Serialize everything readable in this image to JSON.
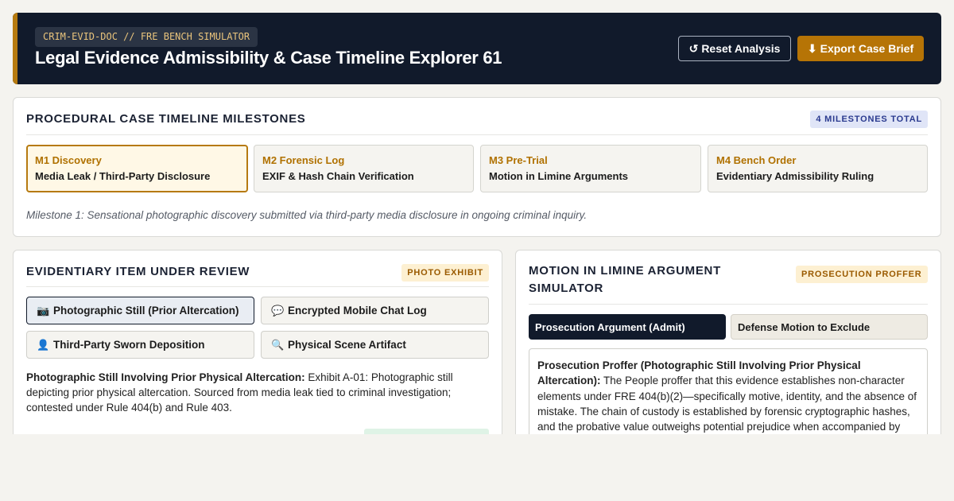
{
  "header": {
    "tag": "CRIM-EVID-DOC // FRE BENCH SIMULATOR",
    "title": "Legal Evidence Admissibility & Case Timeline Explorer 61",
    "reset_icon": "↺",
    "reset_label": "Reset Analysis",
    "export_icon": "⬇",
    "export_label": "Export Case Brief"
  },
  "timeline": {
    "title": "Procedural Case Timeline Milestones",
    "badge": "4 MILESTONES TOTAL",
    "milestones": [
      {
        "code": "M1 Discovery",
        "name": "Media Leak / Third-Party Disclosure"
      },
      {
        "code": "M2 Forensic Log",
        "name": "EXIF & Hash Chain Verification"
      },
      {
        "code": "M3 Pre-Trial",
        "name": "Motion in Limine Arguments"
      },
      {
        "code": "M4 Bench Order",
        "name": "Evidentiary Admissibility Ruling"
      }
    ],
    "caption": "Milestone 1: Sensational photographic discovery submitted via third-party media disclosure in ongoing criminal inquiry."
  },
  "evidence": {
    "title": "Evidentiary Item Under Review",
    "badge": "PHOTO EXHIBIT",
    "items": [
      {
        "icon": "📷",
        "label": "Photographic Still (Prior Altercation)"
      },
      {
        "icon": "💬",
        "label": "Encrypted Mobile Chat Log"
      },
      {
        "icon": "👤",
        "label": "Third-Party Sworn Deposition"
      },
      {
        "icon": "🔍",
        "label": "Physical Scene Artifact"
      }
    ],
    "desc_bold": "Photographic Still Involving Prior Physical Altercation:",
    "desc_text": " Exhibit A-01: Photographic still depicting prior physical altercation. Sourced from media leak tied to criminal investigation; contested under Rule 404(b) and Rule 403."
  },
  "motion": {
    "title": "Motion in Limine Argument Simulator",
    "badge": "PROSECUTION PROFFER",
    "tabs": [
      "Prosecution Argument (Admit)",
      "Defense Motion to Exclude"
    ],
    "argument_bold": "Prosecution Proffer (Photographic Still Involving Prior Physical Altercation):",
    "argument_text": " The People proffer that this evidence establishes non-character elements under FRE 404(b)(2)—specifically motive, identity, and the absence of mistake. The chain of custody is established by forensic cryptographic hashes, and the probative value outweighs potential prejudice when accompanied by"
  },
  "colors": {
    "header_bg": "#111a2b",
    "accent": "#b67a10",
    "export_button": "#b67406"
  }
}
